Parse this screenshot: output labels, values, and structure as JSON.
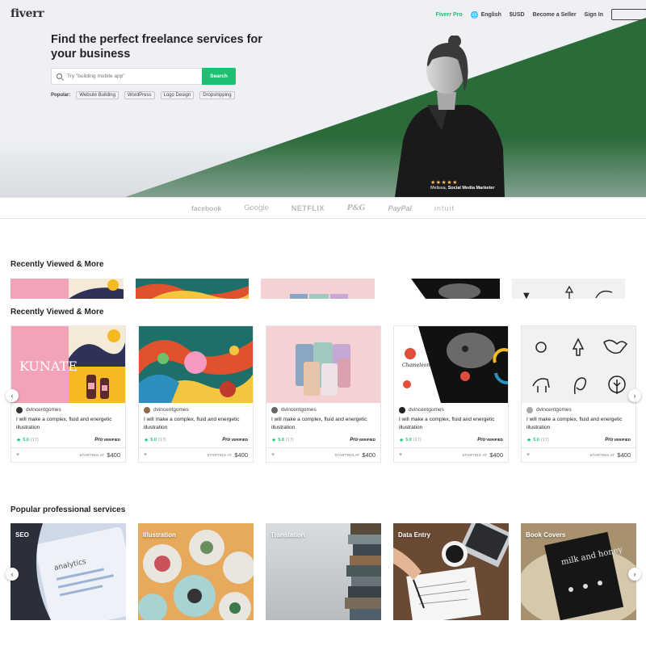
{
  "header": {
    "logo": "fiverr",
    "nav": {
      "pro": "Fiverr Pro",
      "language": "English",
      "currency": "$USD",
      "become_seller": "Become a Seller",
      "sign_in": "Sign In"
    }
  },
  "hero": {
    "headline": "Find the perfect freelance services for your business",
    "search_placeholder": "Try \"building mobile app\"",
    "search_button": "Search",
    "popular_label": "Popular:",
    "popular_tags": [
      "Website Building",
      "WordPress",
      "Logo Design",
      "Dropshipping"
    ],
    "stars": "★★★★★",
    "caption_name": "Melissa,",
    "caption_role": "Social Media Marketer",
    "green": "#2b6b3a"
  },
  "trusted_by": [
    "facebook",
    "Google",
    "NETFLIX",
    "P&G",
    "PayPal",
    "intuit"
  ],
  "sections": {
    "recent_1": "Recently Viewed & More",
    "recent_2": "Recently Viewed & More",
    "popular": "Popular professional services"
  },
  "gigs": [
    {
      "seller": "dvincentgomes",
      "title": "I will make a complex, fluid and energetic illustration",
      "rating": "5.0",
      "count": "(17)",
      "starting": "STARTING AT",
      "price": "$400",
      "verified": "VERIFIED",
      "pro": "Pro"
    },
    {
      "seller": "dvincentgomes",
      "title": "I will make a complex, fluid and energetic illustration",
      "rating": "5.0",
      "count": "(17)",
      "starting": "STARTING AT",
      "price": "$400",
      "verified": "VERIFIED",
      "pro": "Pro"
    },
    {
      "seller": "dvincentgomes",
      "title": "I will make a complex, fluid and energetic illustration",
      "rating": "5.0",
      "count": "(17)",
      "starting": "STARTING AT",
      "price": "$400",
      "verified": "VERIFIED",
      "pro": "Pro"
    },
    {
      "seller": "dvincentgomes",
      "title": "I will make a complex, fluid and energetic illustration",
      "rating": "5.0",
      "count": "(17)",
      "starting": "STARTING AT",
      "price": "$400",
      "verified": "VERIFIED",
      "pro": "Pro"
    },
    {
      "seller": "dvincentgomes",
      "title": "I will make a complex, fluid and energetic illustration",
      "rating": "5.0",
      "count": "(17)",
      "starting": "STARTING AT",
      "price": "$400",
      "verified": "VERIFIED",
      "pro": "Pro"
    }
  ],
  "thumb_text": {
    "kunate": "KUNATE",
    "chameleon": "Chameleon"
  },
  "services": [
    {
      "label": "SEO",
      "art": "analytics"
    },
    {
      "label": "Illustration"
    },
    {
      "label": "Translation"
    },
    {
      "label": "Data Entry"
    },
    {
      "label": "Book Covers",
      "art": "milk and honey"
    }
  ],
  "icons": {
    "prev": "‹",
    "next": "›",
    "heart": "♥",
    "star": "★",
    "globe": "🌐"
  }
}
